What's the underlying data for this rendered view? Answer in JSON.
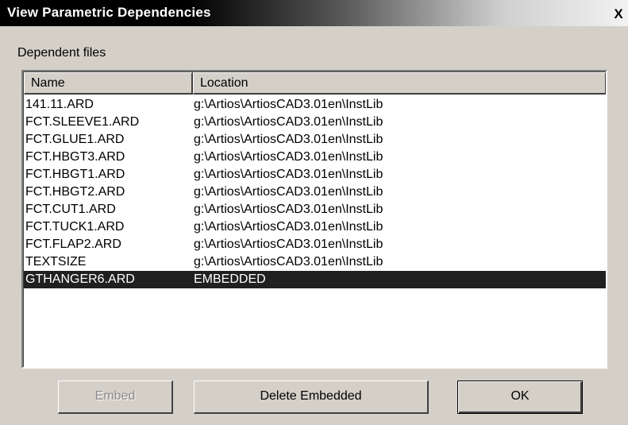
{
  "window": {
    "title": "View Parametric Dependencies",
    "close_label": "X"
  },
  "group": {
    "label": "Dependent files"
  },
  "list": {
    "columns": [
      "Name",
      "Location"
    ],
    "rows": [
      {
        "name": "141.11.ARD",
        "location": "g:\\Artios\\ArtiosCAD3.01en\\InstLib",
        "selected": false
      },
      {
        "name": "FCT.SLEEVE1.ARD",
        "location": "g:\\Artios\\ArtiosCAD3.01en\\InstLib",
        "selected": false
      },
      {
        "name": "FCT.GLUE1.ARD",
        "location": "g:\\Artios\\ArtiosCAD3.01en\\InstLib",
        "selected": false
      },
      {
        "name": "FCT.HBGT3.ARD",
        "location": "g:\\Artios\\ArtiosCAD3.01en\\InstLib",
        "selected": false
      },
      {
        "name": "FCT.HBGT1.ARD",
        "location": "g:\\Artios\\ArtiosCAD3.01en\\InstLib",
        "selected": false
      },
      {
        "name": "FCT.HBGT2.ARD",
        "location": "g:\\Artios\\ArtiosCAD3.01en\\InstLib",
        "selected": false
      },
      {
        "name": "FCT.CUT1.ARD",
        "location": "g:\\Artios\\ArtiosCAD3.01en\\InstLib",
        "selected": false
      },
      {
        "name": "FCT.TUCK1.ARD",
        "location": "g:\\Artios\\ArtiosCAD3.01en\\InstLib",
        "selected": false
      },
      {
        "name": "FCT.FLAP2.ARD",
        "location": "g:\\Artios\\ArtiosCAD3.01en\\InstLib",
        "selected": false
      },
      {
        "name": "TEXTSIZE",
        "location": "g:\\Artios\\ArtiosCAD3.01en\\InstLib",
        "selected": false
      },
      {
        "name": "GTHANGER6.ARD",
        "location": "EMBEDDED",
        "selected": true
      }
    ]
  },
  "buttons": {
    "embed_label": "Embed",
    "embed_enabled": false,
    "delete_label": "Delete Embedded",
    "ok_label": "OK"
  },
  "colors": {
    "face": "#d4d0c8",
    "selection": "#202020",
    "title_text": "#ffffff"
  }
}
